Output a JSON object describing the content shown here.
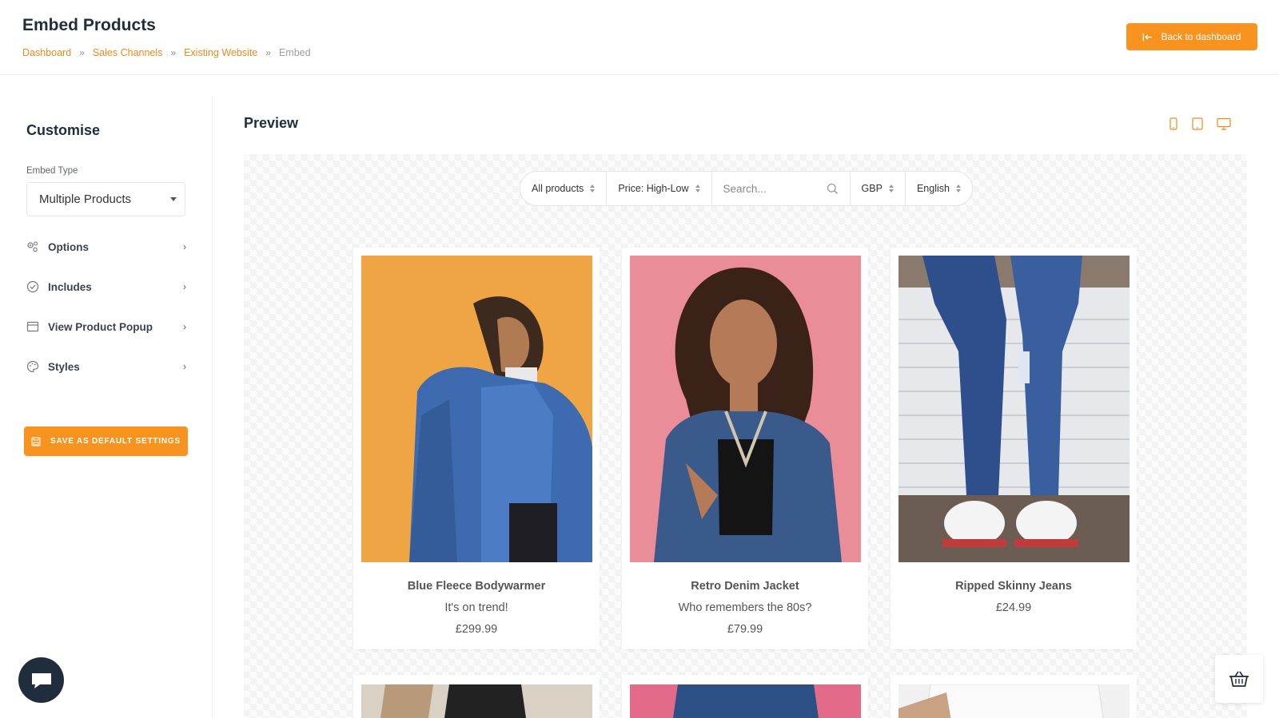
{
  "header": {
    "title": "Embed Products",
    "breadcrumb": [
      "Dashboard",
      "Sales Channels",
      "Existing Website"
    ],
    "breadcrumb_current": "Embed",
    "separator": "»",
    "back_label": "Back to dashboard"
  },
  "sidebar": {
    "title": "Customise",
    "embed_type_label": "Embed Type",
    "embed_type_value": "Multiple Products",
    "items": [
      {
        "label": "Options",
        "icon": "options-gear-icon"
      },
      {
        "label": "Includes",
        "icon": "check-circle-icon"
      },
      {
        "label": "View Product Popup",
        "icon": "window-icon"
      },
      {
        "label": "Styles",
        "icon": "palette-icon"
      }
    ],
    "save_label": "SAVE AS DEFAULT SETTINGS"
  },
  "preview": {
    "title": "Preview",
    "device_icons": [
      "mobile-icon",
      "tablet-icon",
      "desktop-icon"
    ],
    "filters": {
      "category": "All products",
      "sort": "Price: High-Low",
      "search_placeholder": "Search...",
      "currency": "GBP",
      "language": "English"
    },
    "products": [
      {
        "name": "Blue Fleece Bodywarmer",
        "tagline": "It's on trend!",
        "price": "£299.99"
      },
      {
        "name": "Retro Denim Jacket",
        "tagline": "Who remembers the 80s?",
        "price": "£79.99"
      },
      {
        "name": "Ripped Skinny Jeans",
        "tagline": "",
        "price": "£24.99"
      }
    ]
  },
  "colors": {
    "accent": "#f7931e",
    "link": "#f08a1d",
    "heading": "#1f2d3d"
  }
}
